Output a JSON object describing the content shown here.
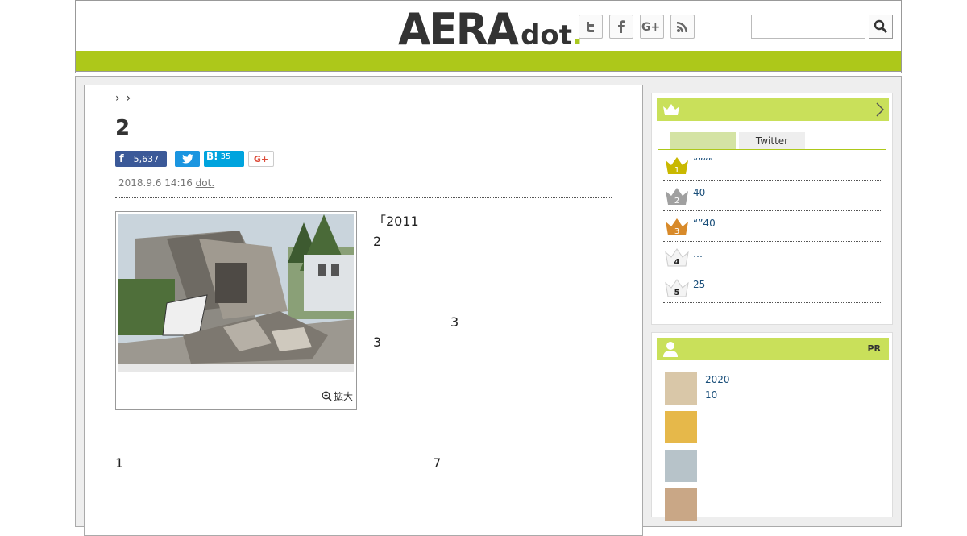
{
  "header": {
    "logo_main": "AERA",
    "logo_sub": "dot",
    "logo_period": ".",
    "social": [
      "twitter-icon",
      "facebook-icon",
      "google-plus-icon",
      "rss-icon"
    ],
    "search_placeholder": ""
  },
  "article": {
    "breadcrumb": [
      "›",
      "›"
    ],
    "title": "2",
    "share": {
      "facebook_count": "5,637",
      "hatena_label": "B!",
      "hatena_count": "35",
      "gplus_label": "G+"
    },
    "date": "2018.9.6 14:16",
    "source": "dot.",
    "zoom_label": "拡大",
    "paragraphs": [
      "「2011　　　　　　　　　　　　　　　　　　　　　　　　　　　　　　　　　　　　　　　　　　　　　　　　　　　　　　　　　　2　　　　　　　　　　　　　　　　　　",
      "　　　　　　3　　　　　　　　　　　　　　　　　　　　3　　　　　　　　　　　　　　　　　　　　　　　　　　　　　　　　　　　　　　　　　　　　　　　　　　　　　　　　　　　　　　　　　　　　　　　　　　　　　　　　　　",
      "　　　　　　　　　　　　　　　　　　　　　　　　　　　　　　　　　　　　　　　　　　　　　　　　　　　　　　　　　　　　　　　1　　　　　　　　　　　　　　　　　　　　　　　　7　　　　　　　　　　　　　　　　　　　　　　　　　　　　"
    ]
  },
  "sidebar": {
    "tabs": [
      "",
      "Twitter"
    ],
    "ranking": [
      {
        "rank": "1",
        "text": "“”“”",
        "color": "#c9b800"
      },
      {
        "rank": "2",
        "text": "40",
        "color": "#a0a0a0"
      },
      {
        "rank": "3",
        "text": "“”40",
        "color": "#d88a2a"
      },
      {
        "rank": "4",
        "text": "…",
        "color": "#ffffff"
      },
      {
        "rank": "5",
        "text": "25",
        "color": "#ffffff"
      }
    ],
    "pr_label": "PR",
    "pr_items": [
      {
        "line1": "2020",
        "line2": "10"
      },
      {
        "line1": "",
        "line2": ""
      },
      {
        "line1": "",
        "line2": ""
      },
      {
        "line1": "",
        "line2": ""
      }
    ]
  },
  "colors": {
    "accent_green": "#adc81a",
    "sidebar_green": "#c9e05a",
    "facebook": "#3b5998",
    "twitter": "#1b95e0",
    "hatena": "#00a4de"
  }
}
